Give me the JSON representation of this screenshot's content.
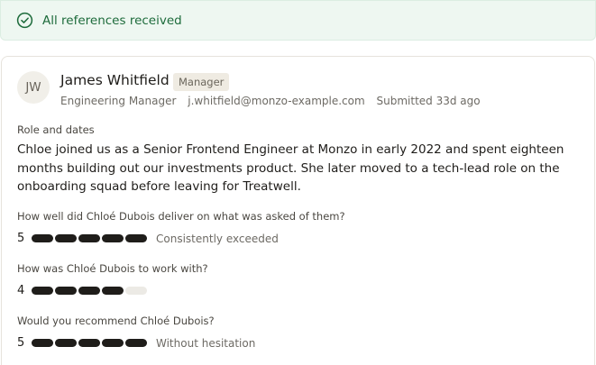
{
  "banner": {
    "text": "All references received",
    "icon": "check-circle-icon",
    "color": "#1d6b3b"
  },
  "referee": {
    "initials": "JW",
    "name": "James Whitfield",
    "badge": "Manager",
    "title": "Engineering Manager",
    "email": "j.whitfield@monzo-example.com",
    "submitted": "Submitted 33d ago"
  },
  "role_section": {
    "label": "Role and dates",
    "text": "Chloe joined us as a Senior Frontend Engineer at Monzo in early 2022 and spent eighteen months building out our investments product. She later moved to a tech-lead role on the onboarding squad before leaving for Treatwell."
  },
  "questions": [
    {
      "question": "How well did Chloé Dubois deliver on what was asked of them?",
      "score": "5",
      "max": 5,
      "label": "Consistently exceeded"
    },
    {
      "question": "How was Chloé Dubois to work with?",
      "score": "4",
      "max": 5,
      "label": ""
    },
    {
      "question": "Would you recommend Chloé Dubois?",
      "score": "5",
      "max": 5,
      "label": "Without hesitation"
    }
  ]
}
